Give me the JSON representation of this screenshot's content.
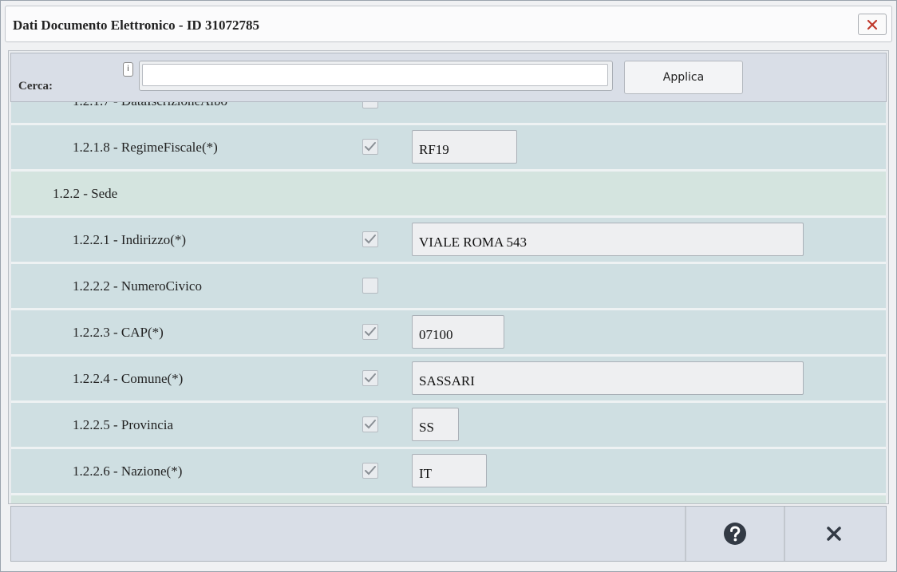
{
  "window": {
    "title": "Dati Documento Elettronico - ID 31072785"
  },
  "search": {
    "label": "Cerca:",
    "info": "i",
    "value": "",
    "placeholder": "",
    "apply_label": "Applica"
  },
  "rows": [
    {
      "kind": "field",
      "label": "1.2.1.7 - DataIscrizioneAlbo",
      "checked": false,
      "value": null
    },
    {
      "kind": "field",
      "label": "1.2.1.8 - RegimeFiscale(*)",
      "checked": true,
      "value": "RF19"
    },
    {
      "kind": "group",
      "label": "1.2.2 - Sede"
    },
    {
      "kind": "field",
      "label": "1.2.2.1 - Indirizzo(*)",
      "checked": true,
      "value": "VIALE ROMA 543"
    },
    {
      "kind": "field",
      "label": "1.2.2.2 - NumeroCivico",
      "checked": false,
      "value": null
    },
    {
      "kind": "field",
      "label": "1.2.2.3 - CAP(*)",
      "checked": true,
      "value": "07100"
    },
    {
      "kind": "field",
      "label": "1.2.2.4 - Comune(*)",
      "checked": true,
      "value": "SASSARI"
    },
    {
      "kind": "field",
      "label": "1.2.2.5 - Provincia",
      "checked": true,
      "value": "SS"
    },
    {
      "kind": "field",
      "label": "1.2.2.6 - Nazione(*)",
      "checked": true,
      "value": "IT"
    },
    {
      "kind": "group",
      "label": ""
    }
  ],
  "footer": {
    "help_icon": "question-circle-icon",
    "close_icon": "close-x-icon"
  },
  "colors": {
    "field_row": "#cfdfe2",
    "group_row": "#d4e4df",
    "close_red": "#c0392b",
    "icon_dark": "#333a45"
  }
}
